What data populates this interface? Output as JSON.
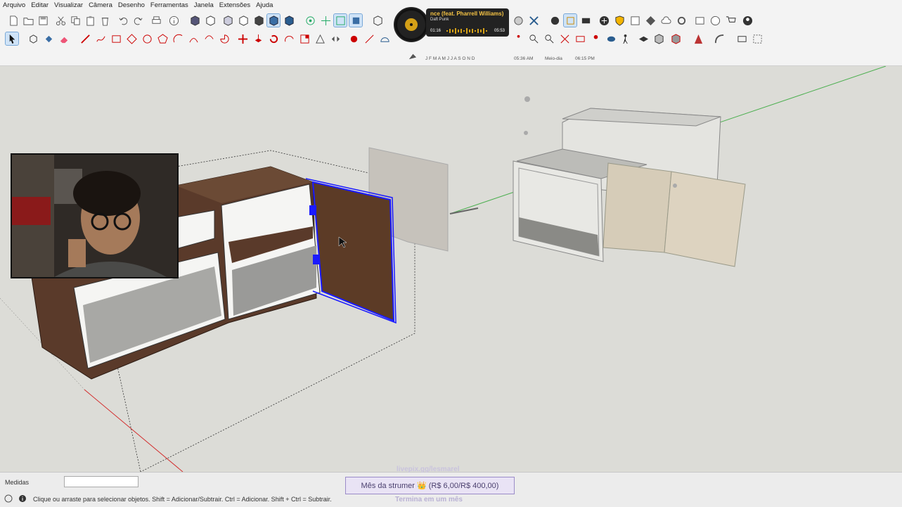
{
  "menu": [
    "Arquivo",
    "Editar",
    "Visualizar",
    "Câmera",
    "Desenho",
    "Ferramentas",
    "Janela",
    "Extensões",
    "Ajuda"
  ],
  "now_playing": {
    "title": "nce (feat. Pharrell Williams)",
    "artist": "Daft Punk",
    "elapsed": "01:16",
    "duration": "05:53"
  },
  "shadow": {
    "months": "J F M A M J J A S O N D",
    "time_start": "05:36 AM",
    "time_mid": "Meio-dia",
    "time_end": "06:15 PM"
  },
  "status": {
    "medidas_label": "Medidas",
    "medidas_value": "",
    "hint": "Clique ou arraste para selecionar objetos. Shift = Adicionar/Subtrair. Ctrl = Adicionar. Shift + Ctrl = Subtrair."
  },
  "sub_goal": {
    "top_text": "livepix.gg/lesmarel",
    "label": "Mês da strumer 👑 (R$ 6,00/R$ 400,00)",
    "bottom_text": "Termina em um mês"
  },
  "colors": {
    "selection_blue": "#1a1aff",
    "wood_dark": "#5a3a2a",
    "wood_light": "#d6ccb8",
    "axis_green": "#4caf50",
    "axis_red": "#d32f2f"
  }
}
